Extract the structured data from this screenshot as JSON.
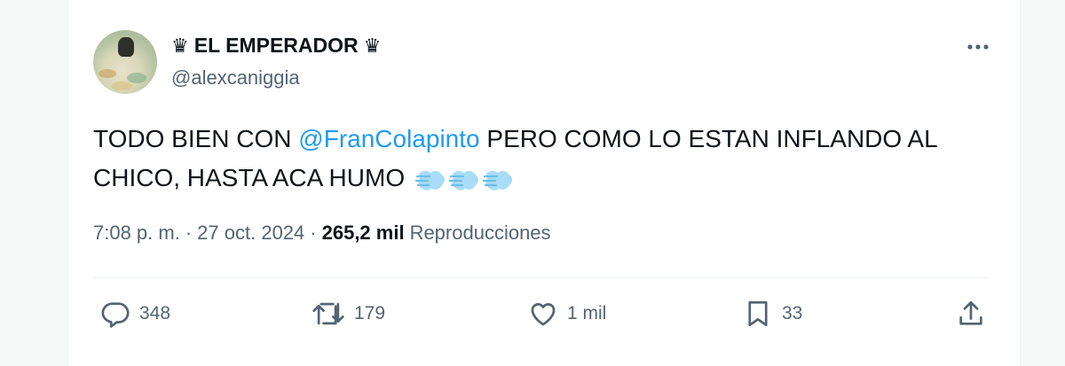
{
  "author": {
    "display_name": "EL EMPERADOR",
    "crown_left": "♛",
    "crown_right": "♛",
    "handle": "@alexcaniggia"
  },
  "tweet": {
    "text_before": "TODO BIEN CON ",
    "mention": "@FranColapinto",
    "text_after": " PERO COMO LO ESTAN INFLANDO AL CHICO, HASTA ACA HUMO",
    "emoji_name": "dashing-away-emoji",
    "emoji_count": 3
  },
  "meta": {
    "time": "7:08 p. m.",
    "sep1": "·",
    "date": "27 oct. 2024",
    "sep2": "·",
    "views_count": "265,2 mil",
    "views_label": "Reproducciones"
  },
  "actions": {
    "replies": "348",
    "reposts": "179",
    "likes": "1 mil",
    "bookmarks": "33"
  },
  "icons": {
    "reply": "reply-bubble-icon",
    "repost": "repost-icon",
    "like": "heart-icon",
    "bookmark": "bookmark-icon",
    "share": "share-icon",
    "more": "more-dots-icon"
  },
  "colors": {
    "link": "#1d9bf0",
    "text": "#0f1419",
    "secondary": "#536471",
    "puff": "#7ec8f0"
  }
}
